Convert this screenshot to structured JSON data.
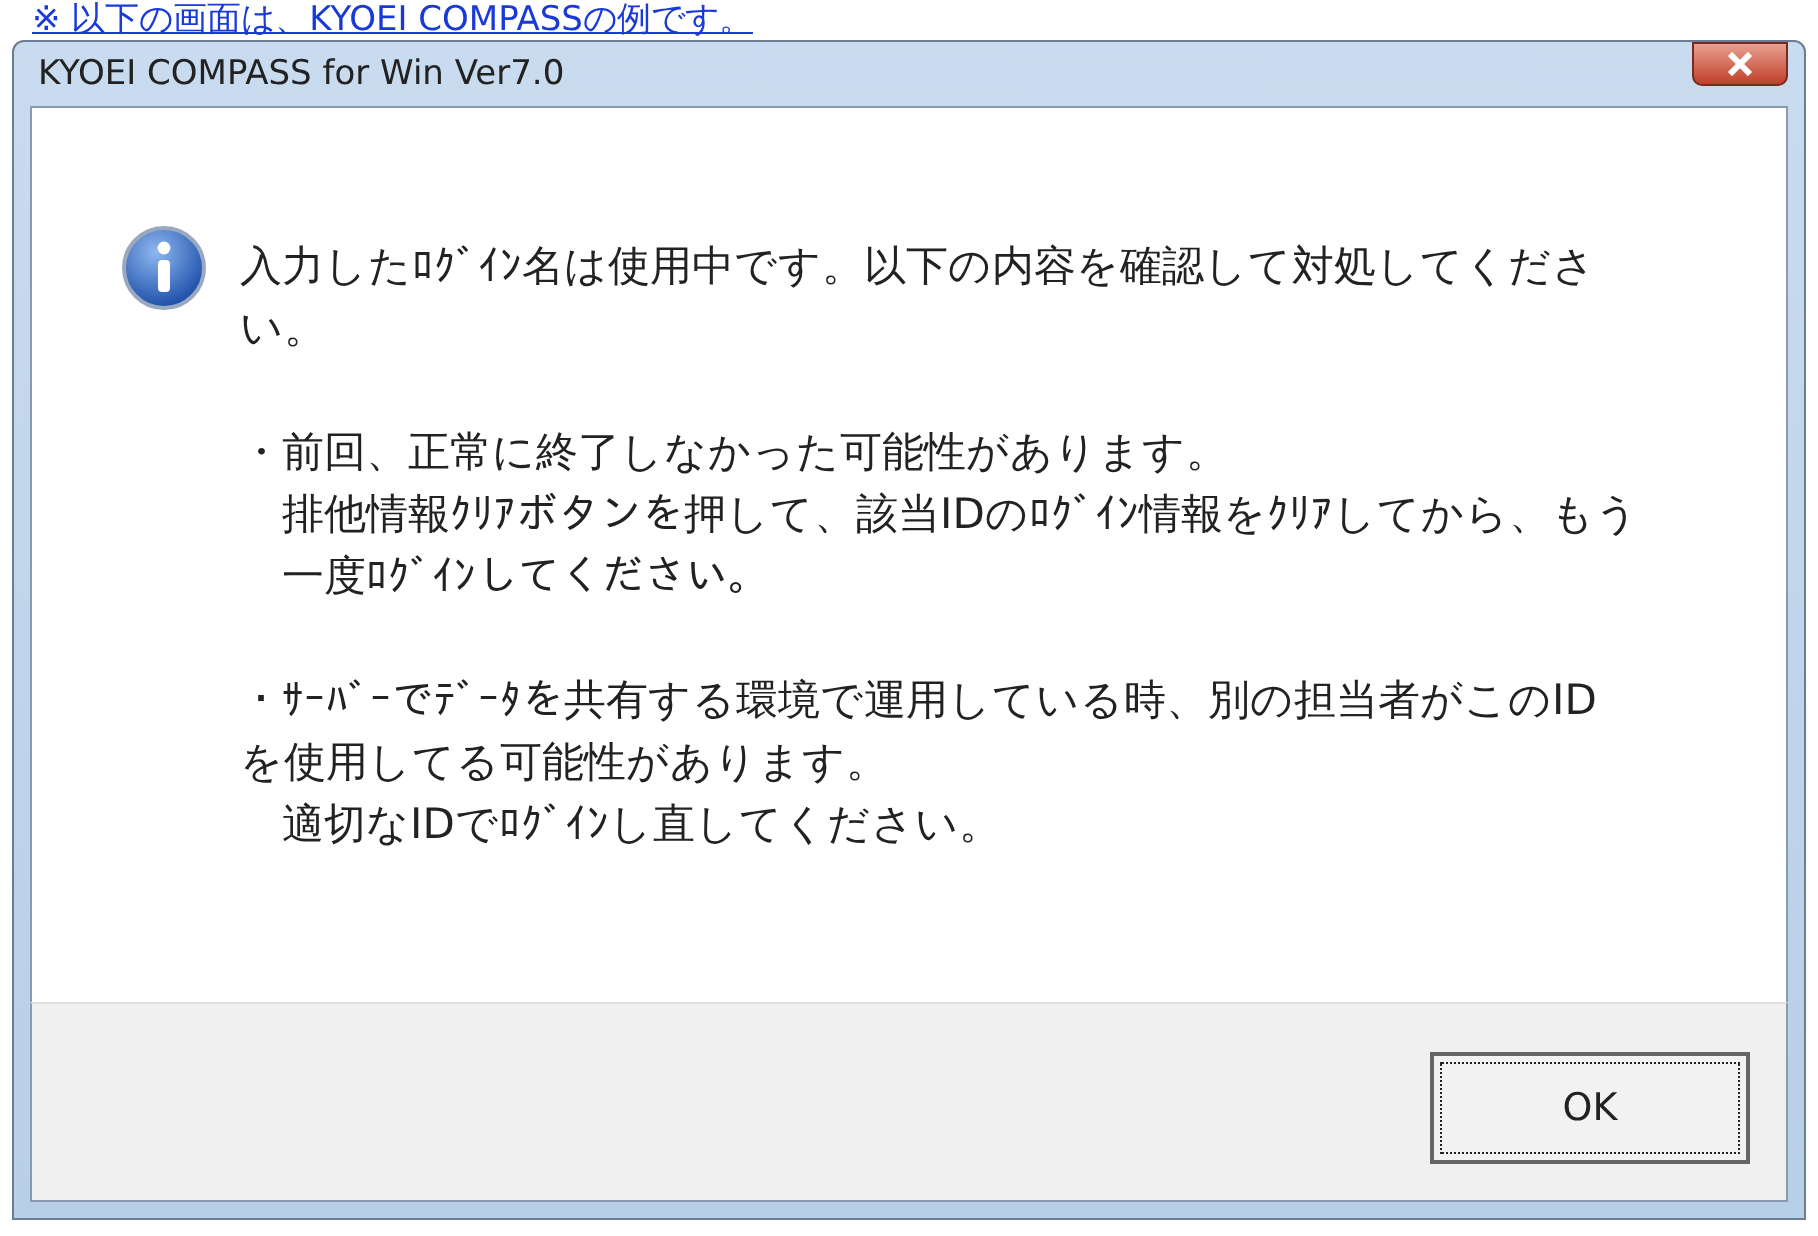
{
  "caption": "※ 以下の画面は、KYOEI COMPASSの例です。",
  "window": {
    "title": "KYOEI COMPASS for Win Ver7.0"
  },
  "message": {
    "kind": "info",
    "paragraphs": [
      {
        "lines": [
          {
            "text": "入力したﾛｸﾞｲﾝ名は使用中です。以下の内容を確認して対処してください。",
            "indent": false
          }
        ]
      },
      {
        "lines": [
          {
            "text": "・前回、正常に終了しなかった可能性があります。",
            "indent": false
          },
          {
            "text": "排他情報ｸﾘｱボタンを押して、該当IDのﾛｸﾞｲﾝ情報をｸﾘｱしてから、もう一度ﾛｸﾞｲﾝしてください。",
            "indent": true
          }
        ]
      },
      {
        "lines": [
          {
            "text": "・ｻｰﾊﾞｰでﾃﾞｰﾀを共有する環境で運用している時、別の担当者がこのIDを使用してる可能性があります。",
            "indent": false
          },
          {
            "text": "適切なIDでﾛｸﾞｲﾝし直してください。",
            "indent": true
          }
        ]
      }
    ]
  },
  "buttons": [
    {
      "label": "OK",
      "focused": true
    }
  ]
}
